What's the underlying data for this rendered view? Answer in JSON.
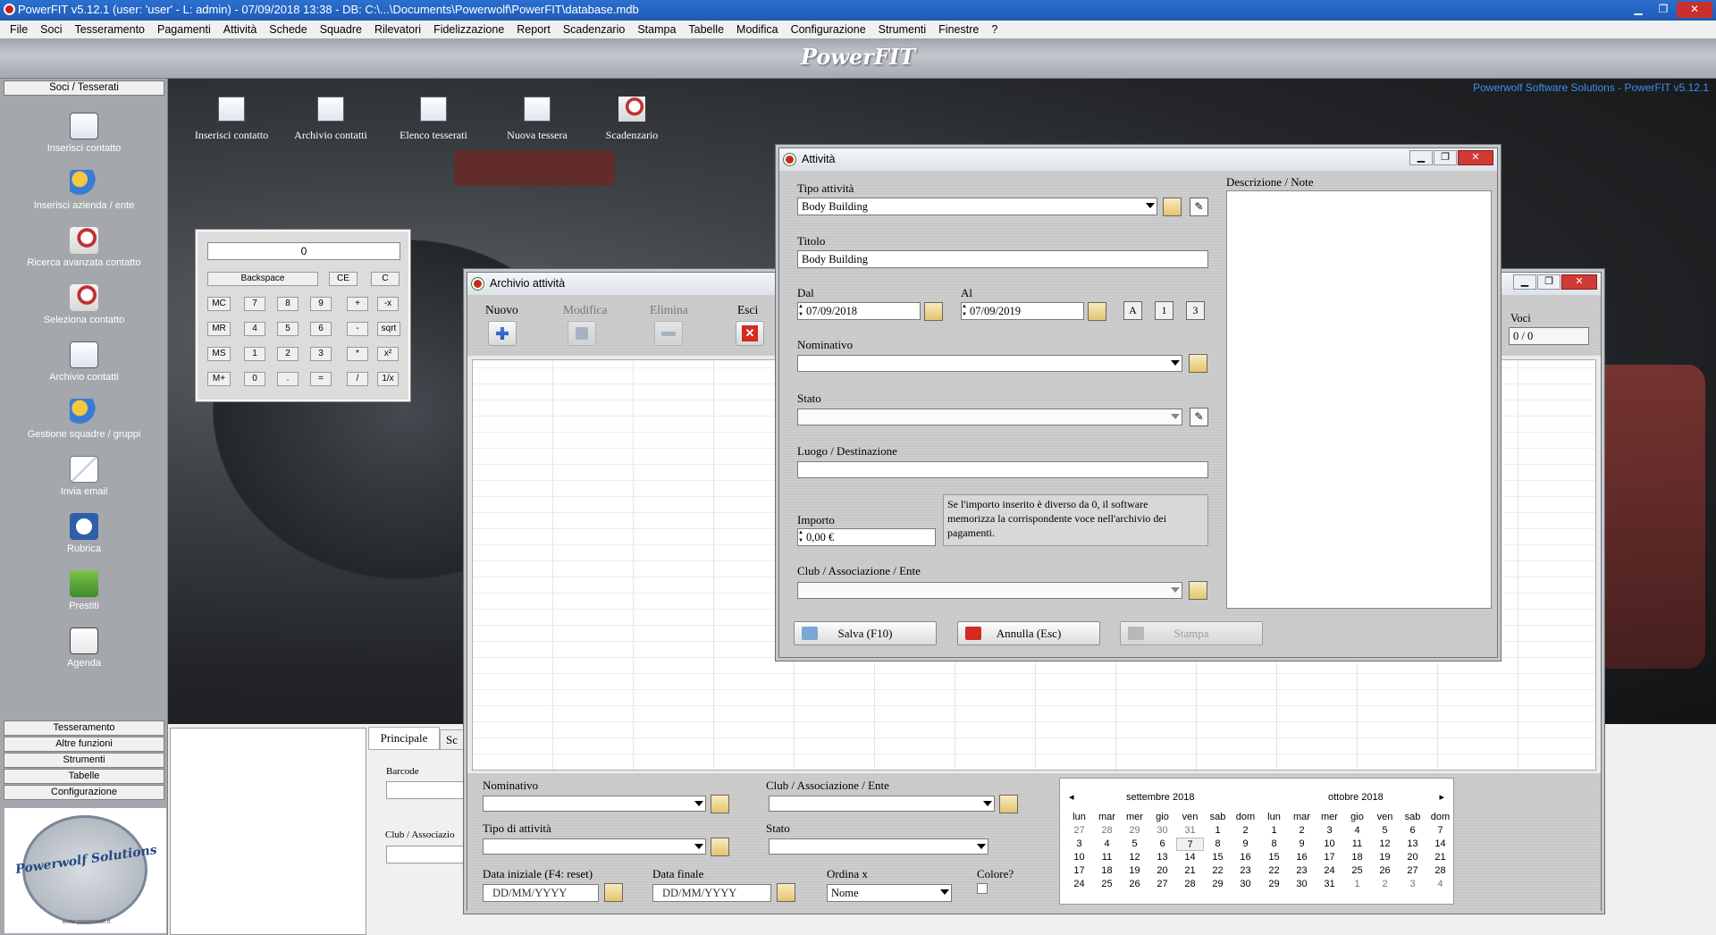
{
  "app": {
    "title": "PowerFIT v5.12.1  (user: 'user'  - L: admin) - 07/09/2018 13:38 - DB: C:\\...\\Documents\\Powerwolf\\PowerFIT\\database.mdb",
    "brand": "PowerFIT",
    "credit": "Powerwolf Software Solutions - PowerFIT v5.12.1"
  },
  "menu": [
    "File",
    "Soci",
    "Tesseramento",
    "Pagamenti",
    "Attività",
    "Schede",
    "Squadre",
    "Rilevatori",
    "Fidelizzazione",
    "Report",
    "Scadenzario",
    "Stampa",
    "Tabelle",
    "Modifica",
    "Configurazione",
    "Strumenti",
    "Finestre",
    "?"
  ],
  "sidebar": {
    "header": "Soci / Tesserati",
    "items": [
      {
        "label": "Inserisci contatto",
        "icon": "contact-card-icon"
      },
      {
        "label": "Inserisci azienda / ente",
        "icon": "people-group-icon"
      },
      {
        "label": "Ricerca avanzata contatto",
        "icon": "advanced-search-icon"
      },
      {
        "label": "Seleziona contatto",
        "icon": "select-contact-icon"
      },
      {
        "label": "Archivio contatti",
        "icon": "contacts-archive-icon"
      },
      {
        "label": "Gestione squadre / gruppi",
        "icon": "groups-icon"
      },
      {
        "label": "Invia email",
        "icon": "email-icon"
      },
      {
        "label": "Rubrica",
        "icon": "phonebook-icon"
      },
      {
        "label": "Prestiti",
        "icon": "loans-icon"
      },
      {
        "label": "Agenda",
        "icon": "agenda-icon"
      }
    ],
    "sections": [
      "Tesseramento",
      "Altre funzioni",
      "Strumenti",
      "Tabelle",
      "Configurazione"
    ],
    "logo_text": "Powerwolf Solutions",
    "logo_site": "www.powerwolf.it"
  },
  "toolbar": [
    {
      "label": "Inserisci contatto",
      "icon": "contact-card-icon"
    },
    {
      "label": "Archivio contatti",
      "icon": "contacts-archive-icon"
    },
    {
      "label": "Elenco tesserati",
      "icon": "members-list-icon"
    },
    {
      "label": "Nuova tessera",
      "icon": "new-card-icon"
    },
    {
      "label": "Scadenzario",
      "icon": "deadlines-icon"
    }
  ],
  "calculator": {
    "display": "0",
    "row0": [
      "Backspace",
      "CE",
      "C"
    ],
    "row1": [
      "MC",
      "7",
      "8",
      "9",
      "+",
      "-x"
    ],
    "row2": [
      "MR",
      "4",
      "5",
      "6",
      "-",
      "sqrt"
    ],
    "row3": [
      "MS",
      "1",
      "2",
      "3",
      "*",
      "x²"
    ],
    "row4": [
      "M+",
      "0",
      ".",
      "=",
      "/",
      "1/x"
    ]
  },
  "archivio": {
    "title": "Archivio attività",
    "btn_nuovo": "Nuovo",
    "btn_modifica": "Modifica",
    "btn_elimina": "Elimina",
    "btn_esci": "Esci",
    "voci_label": "Voci",
    "voci_value": "0 / 0",
    "filters": {
      "nominativo": "Nominativo",
      "club": "Club / Associazione / Ente",
      "tipo": "Tipo di attività",
      "stato": "Stato",
      "data_iniziale": "Data iniziale (F4: reset)",
      "data_finale": "Data finale",
      "ordina": "Ordina x",
      "ordina_value": "Nome",
      "colore": "Colore?",
      "date_placeholder": "DD/MM/YYYY"
    }
  },
  "bottom_panel": {
    "tab_principale": "Principale",
    "tab_other": "Sc",
    "barcode": "Barcode",
    "club": "Club / Associazio"
  },
  "calendar": {
    "month1": "settembre 2018",
    "month2": "ottobre 2018",
    "weekdays": [
      "lun",
      "mar",
      "mer",
      "gio",
      "ven",
      "sab",
      "dom"
    ],
    "days1": [
      "27",
      "28",
      "29",
      "30",
      "31",
      "1",
      "2",
      "3",
      "4",
      "5",
      "6",
      "7",
      "8",
      "9",
      "10",
      "11",
      "12",
      "13",
      "14",
      "15",
      "16",
      "17",
      "18",
      "19",
      "20",
      "21",
      "22",
      "23",
      "24",
      "25",
      "26",
      "27",
      "28",
      "29",
      "30"
    ],
    "days2": [
      "1",
      "2",
      "3",
      "4",
      "5",
      "6",
      "7",
      "8",
      "9",
      "10",
      "11",
      "12",
      "13",
      "14",
      "15",
      "16",
      "17",
      "18",
      "19",
      "20",
      "21",
      "22",
      "23",
      "24",
      "25",
      "26",
      "27",
      "28",
      "29",
      "30",
      "31",
      "1",
      "2",
      "3",
      "4"
    ]
  },
  "attivita": {
    "title": "Attività",
    "tipo_label": "Tipo attività",
    "tipo_value": "Body Building",
    "titolo_label": "Titolo",
    "titolo_value": "Body Building",
    "dal_label": "Dal",
    "dal_value": "07/09/2018",
    "al_label": "Al",
    "al_value": "07/09/2019",
    "btn_a": "A",
    "btn_1": "1",
    "btn_3": "3",
    "nominativo_label": "Nominativo",
    "stato_label": "Stato",
    "luogo_label": "Luogo / Destinazione",
    "importo_label": "Importo",
    "importo_value": "0,00 €",
    "importo_note": "Se l'importo inserito è diverso da 0, il software memorizza la corrispondente voce nell'archivio dei pagamenti.",
    "club_label": "Club / Associazione / Ente",
    "descr_label": "Descrizione / Note",
    "btn_salva": "Salva (F10)",
    "btn_annulla": "Annulla (Esc)",
    "btn_stampa": "Stampa"
  }
}
